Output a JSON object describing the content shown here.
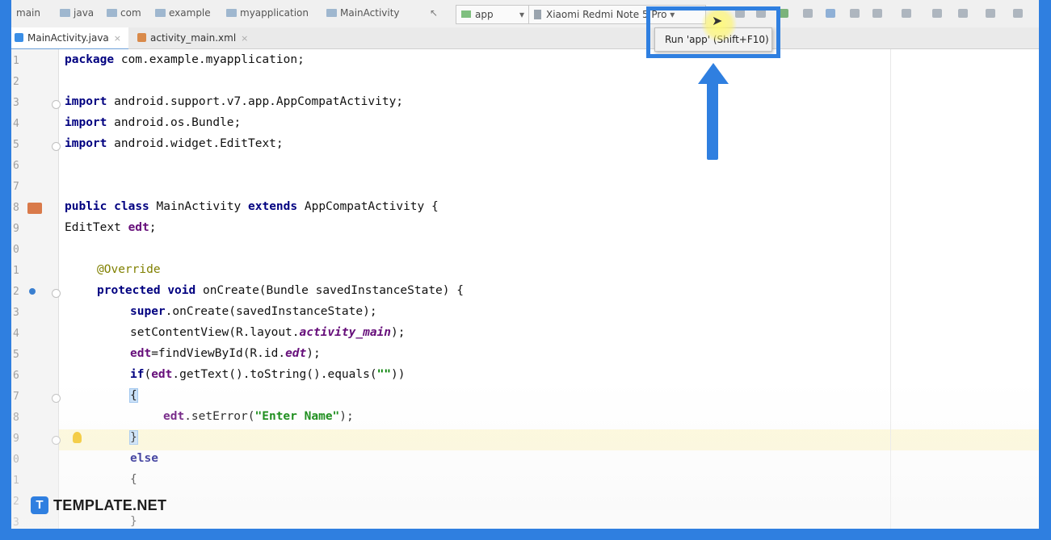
{
  "toolbar": {
    "breadcrumbs": [
      "main",
      "java",
      "com",
      "example",
      "myapplication",
      "MainActivity"
    ],
    "run_config": "app",
    "device": "Xiaomi Redmi Note 5 Pro"
  },
  "tabs": [
    {
      "label": "MainActivity.java",
      "close": "×"
    },
    {
      "label": "activity_main.xml",
      "close": "×"
    }
  ],
  "run_menu": {
    "item": "Run 'app'  (Shift+F10)"
  },
  "line_numbers": [
    "1",
    "2",
    "3",
    "4",
    "5",
    "6",
    "7",
    "8",
    "9",
    "0",
    "1",
    "2",
    "3",
    "4",
    "5",
    "6",
    "7",
    "8",
    "9",
    "0",
    "1",
    "2",
    "3"
  ],
  "code": {
    "l1": [
      "package",
      " com.example.myapplication;"
    ],
    "l3": [
      "import",
      " android.support.v7.app.AppCompatActivity;"
    ],
    "l4": [
      "import",
      " android.os.Bundle;"
    ],
    "l5": [
      "import",
      " android.widget.EditText;"
    ],
    "l8": [
      "public",
      "class",
      "MainActivity",
      "extends",
      "AppCompatActivity {"
    ],
    "l9": [
      "EditText ",
      "edt",
      ";"
    ],
    "l11": "@Override",
    "l12": [
      "protected",
      "void",
      " onCreate(Bundle savedInstanceState) {"
    ],
    "l13": [
      "super",
      ".onCreate(savedInstanceState);"
    ],
    "l14": [
      "setContentView(R.layout.",
      "activity_main",
      ");"
    ],
    "l15": [
      "edt",
      "=findViewById(R.id.",
      "edt",
      ");"
    ],
    "l16": [
      "if",
      "(",
      "edt",
      ".getText().toString().equals(",
      "\"\"",
      "))"
    ],
    "l17": "{",
    "l18": [
      "edt",
      ".setError(",
      "\"Enter Name\"",
      ");"
    ],
    "l19": "}",
    "l20": "else",
    "l21": "{",
    "l23": "}"
  },
  "watermark": {
    "logo": "T",
    "text": "TEMPLATE.NET"
  },
  "colors": {
    "accent": "#2f7fe0",
    "keyword": "#000080",
    "string": "#008000",
    "annotation": "#808000"
  }
}
